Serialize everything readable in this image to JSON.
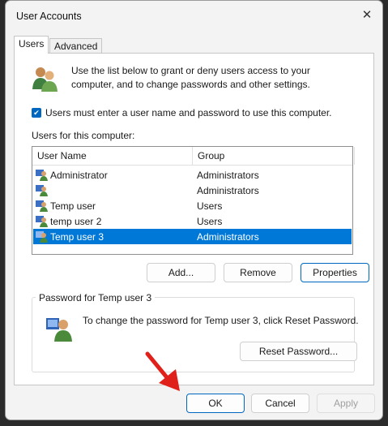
{
  "window": {
    "title": "User Accounts"
  },
  "tabs": [
    {
      "label": "Users"
    },
    {
      "label": "Advanced"
    }
  ],
  "intro_text": "Use the list below to grant or deny users access to your computer, and to change passwords and other settings.",
  "require_login": {
    "checked": true,
    "label": "Users must enter a user name and password to use this computer."
  },
  "users_label": "Users for this computer:",
  "user_list": {
    "columns": [
      "User Name",
      "Group"
    ],
    "rows": [
      {
        "name": "Administrator",
        "group": "Administrators"
      },
      {
        "name": "",
        "group": "Administrators"
      },
      {
        "name": "Temp user",
        "group": "Users"
      },
      {
        "name": "temp user 2",
        "group": "Users"
      },
      {
        "name": "Temp user 3",
        "group": "Administrators",
        "selected": true
      }
    ]
  },
  "list_buttons": {
    "add": "Add...",
    "remove": "Remove",
    "properties": "Properties"
  },
  "password_group": {
    "legend": "Password for Temp user 3",
    "text": "To change the password for Temp user 3, click Reset Password.",
    "reset_button": "Reset Password..."
  },
  "dialog_buttons": {
    "ok": "OK",
    "cancel": "Cancel",
    "apply": "Apply"
  },
  "colors": {
    "accent": "#0067c0",
    "selection": "#0078d7",
    "arrow": "#e0201a"
  }
}
